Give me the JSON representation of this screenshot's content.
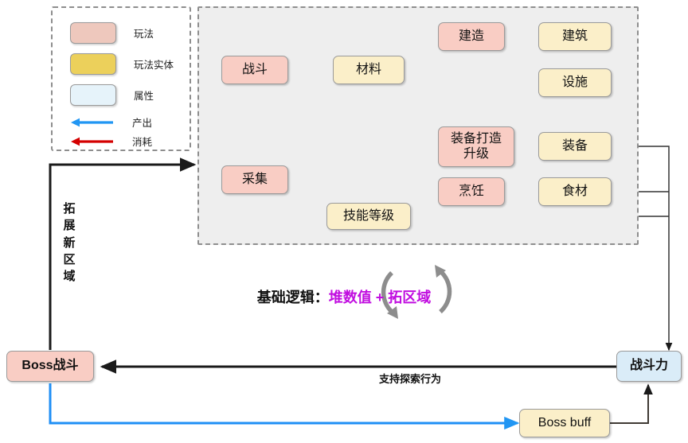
{
  "legend": {
    "title": "legend",
    "items": [
      {
        "type": "swatch",
        "style": "play",
        "label": "玩法"
      },
      {
        "type": "swatch",
        "style": "ent",
        "label": "玩法实体"
      },
      {
        "type": "swatch",
        "style": "attr",
        "label": "属性"
      },
      {
        "type": "arrow",
        "style": "produce",
        "color": "#2196f3",
        "label": "产出"
      },
      {
        "type": "arrow",
        "style": "consume",
        "color": "#d40000",
        "label": "消耗"
      }
    ]
  },
  "nodes": {
    "zhandou": "战斗",
    "caiji": "采集",
    "cailiao": "材料",
    "jineng": "技能等级",
    "jianzao": "建造",
    "jianzhu": "建筑",
    "sheshi": "设施",
    "zhuangbeidazao": "装备打造\n升级",
    "zhuangbei": "装备",
    "pengren": "烹饪",
    "shicai": "食材",
    "boss_zhandou": "Boss战斗",
    "zhandouli": "战斗力",
    "boss_buff": "Boss buff"
  },
  "labels": {
    "expand_area": "拓展新区域",
    "expand_area_chars": [
      "拓",
      "展",
      "新",
      "区",
      "域"
    ],
    "support_explore": "支持探索行为",
    "core_logic_prefix": "基础逻辑：",
    "core_logic_value": "堆数值 + 拓区域"
  },
  "colors": {
    "play_fill": "#f9cdc4",
    "entity_fill": "#fbefc9",
    "attribute_fill": "#daecf8",
    "produce_arrow": "#2196f3",
    "consume_arrow": "#d40000",
    "plain_arrow": "#1a1a1a",
    "accent_text": "#c10ee0",
    "panel_bg": "#eeeeee",
    "panel_border": "#8e8e8e"
  },
  "edges": [
    {
      "from": "战斗",
      "to": "材料",
      "kind": "产出"
    },
    {
      "from": "战斗",
      "to": "技能等级",
      "kind": "产出"
    },
    {
      "from": "采集",
      "to": "材料",
      "kind": "产出"
    },
    {
      "from": "采集",
      "to": "技能等级",
      "kind": "产出"
    },
    {
      "from": "材料",
      "to": "建造",
      "kind": "消耗"
    },
    {
      "from": "材料",
      "to": "烹饪",
      "kind": "消耗"
    },
    {
      "from": "建造",
      "to": "建筑",
      "kind": "产出"
    },
    {
      "from": "建造",
      "to": "设施",
      "kind": "产出"
    },
    {
      "from": "设施",
      "to": "装备打造升级",
      "kind": "消耗"
    },
    {
      "from": "装备打造升级",
      "to": "装备",
      "kind": "产出"
    },
    {
      "from": "烹饪",
      "to": "食材",
      "kind": "产出"
    },
    {
      "from": "装备",
      "to": "战斗力",
      "kind": "普通"
    },
    {
      "from": "食材",
      "to": "战斗力",
      "kind": "普通"
    },
    {
      "from": "技能等级",
      "to": "战斗力",
      "kind": "普通"
    },
    {
      "from": "战斗力",
      "to": "Boss战斗",
      "kind": "支持探索行为"
    },
    {
      "from": "Boss战斗",
      "to": "玩法区域",
      "kind": "拓展新区域"
    },
    {
      "from": "Boss战斗",
      "to": "Boss buff",
      "kind": "产出"
    },
    {
      "from": "Boss buff",
      "to": "战斗力",
      "kind": "普通"
    }
  ]
}
